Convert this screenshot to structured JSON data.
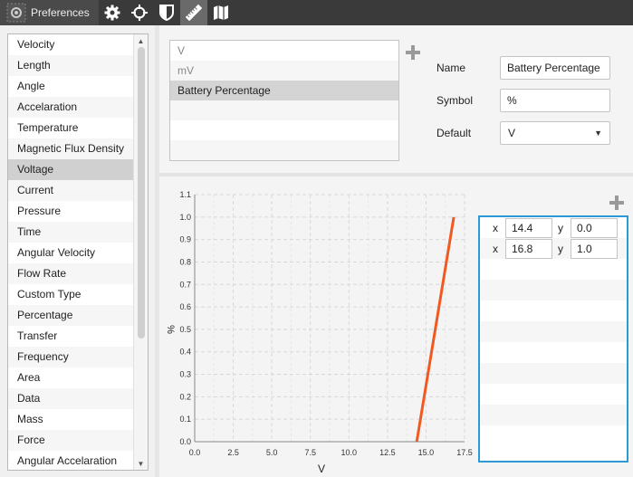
{
  "toolbar": {
    "preferences_label": "Preferences",
    "icons": [
      "gear-icon",
      "crosshair-icon",
      "shield-icon",
      "ruler-icon",
      "map-icon"
    ]
  },
  "categories": {
    "items": [
      "Velocity",
      "Length",
      "Angle",
      "Accelaration",
      "Temperature",
      "Magnetic Flux Density",
      "Voltage",
      "Current",
      "Pressure",
      "Time",
      "Angular Velocity",
      "Flow Rate",
      "Custom Type",
      "Percentage",
      "Transfer",
      "Frequency",
      "Area",
      "Data",
      "Mass",
      "Force",
      "Angular Accelaration"
    ],
    "selected": "Voltage"
  },
  "units": {
    "items": [
      "V",
      "mV",
      "Battery Percentage"
    ],
    "selected": "Battery Percentage"
  },
  "form": {
    "name_label": "Name",
    "name_value": "Battery Percentage",
    "symbol_label": "Symbol",
    "symbol_value": "%",
    "default_label": "Default",
    "default_value": "V"
  },
  "chart_data": {
    "type": "line",
    "xlabel": "V",
    "ylabel": "%",
    "xlim": [
      0,
      17.5
    ],
    "ylim": [
      0,
      1.1
    ],
    "xticks": [
      "0.0",
      "2.5",
      "5.0",
      "7.5",
      "10.0",
      "12.5",
      "15.0",
      "17.5"
    ],
    "yticks": [
      "0.0",
      "0.1",
      "0.2",
      "0.3",
      "0.4",
      "0.5",
      "0.6",
      "0.7",
      "0.8",
      "0.9",
      "1.0",
      "1.1"
    ],
    "grid": true,
    "series": [
      {
        "x": [
          14.4,
          16.8
        ],
        "y": [
          0.0,
          1.0
        ],
        "color": "#f05a22"
      }
    ]
  },
  "points": {
    "x_label": "x",
    "y_label": "y",
    "rows": [
      {
        "x": "14.4",
        "y": "0.0"
      },
      {
        "x": "16.8",
        "y": "1.0"
      }
    ]
  },
  "colors": {
    "toolbar_bg": "#3a3a3a",
    "line": "#f05a22",
    "panel_border_focus": "#2c9ad6",
    "selection": "#d0d0d0"
  }
}
